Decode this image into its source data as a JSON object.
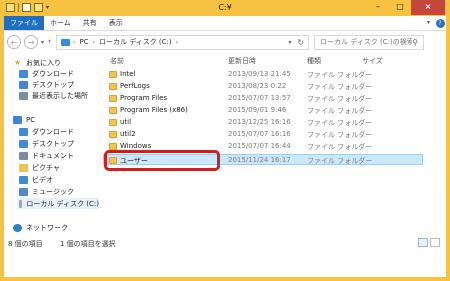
{
  "window": {
    "title": "C:¥"
  },
  "ribbon": {
    "tabs": [
      "ファイル",
      "ホーム",
      "共有",
      "表示"
    ],
    "help": "?"
  },
  "address": {
    "crumbs": [
      "PC",
      "ローカル ディスク (C:)"
    ],
    "separator": "›"
  },
  "search": {
    "placeholder": "ローカル ディスク (C:)の検索"
  },
  "nav": {
    "favorites": "お気に入り",
    "fav_items": [
      "ダウンロード",
      "デスクトップ",
      "最近表示した場所"
    ],
    "pc": "PC",
    "pc_items": [
      "ダウンロード",
      "デスクトップ",
      "ドキュメント",
      "ピクチャ",
      "ビデオ",
      "ミュージック",
      "ローカル ディスク (C:)"
    ],
    "network": "ネットワーク"
  },
  "columns": {
    "name": "名前",
    "date": "更新日時",
    "type": "種類",
    "size": "サイズ"
  },
  "files": [
    {
      "name": "Intel",
      "date": "2013/09/13 21:45",
      "type": "ファイル フォルダー"
    },
    {
      "name": "PerfLogs",
      "date": "2013/08/23 0:22",
      "type": "ファイル フォルダー"
    },
    {
      "name": "Program Files",
      "date": "2015/07/07 13:57",
      "type": "ファイル フォルダー"
    },
    {
      "name": "Program Files (x86)",
      "date": "2015/09/01 9:46",
      "type": "ファイル フォルダー"
    },
    {
      "name": "util",
      "date": "2013/12/25 16:16",
      "type": "ファイル フォルダー"
    },
    {
      "name": "util2",
      "date": "2015/07/07 16:16",
      "type": "ファイル フォルダー"
    },
    {
      "name": "Windows",
      "date": "2015/07/07 16:44",
      "type": "ファイル フォルダー"
    },
    {
      "name": "ユーザー",
      "date": "2015/11/24 16:17",
      "type": "ファイル フォルダー"
    }
  ],
  "status": {
    "count": "8 個の項目",
    "selected": "1 個の項目を選択"
  }
}
